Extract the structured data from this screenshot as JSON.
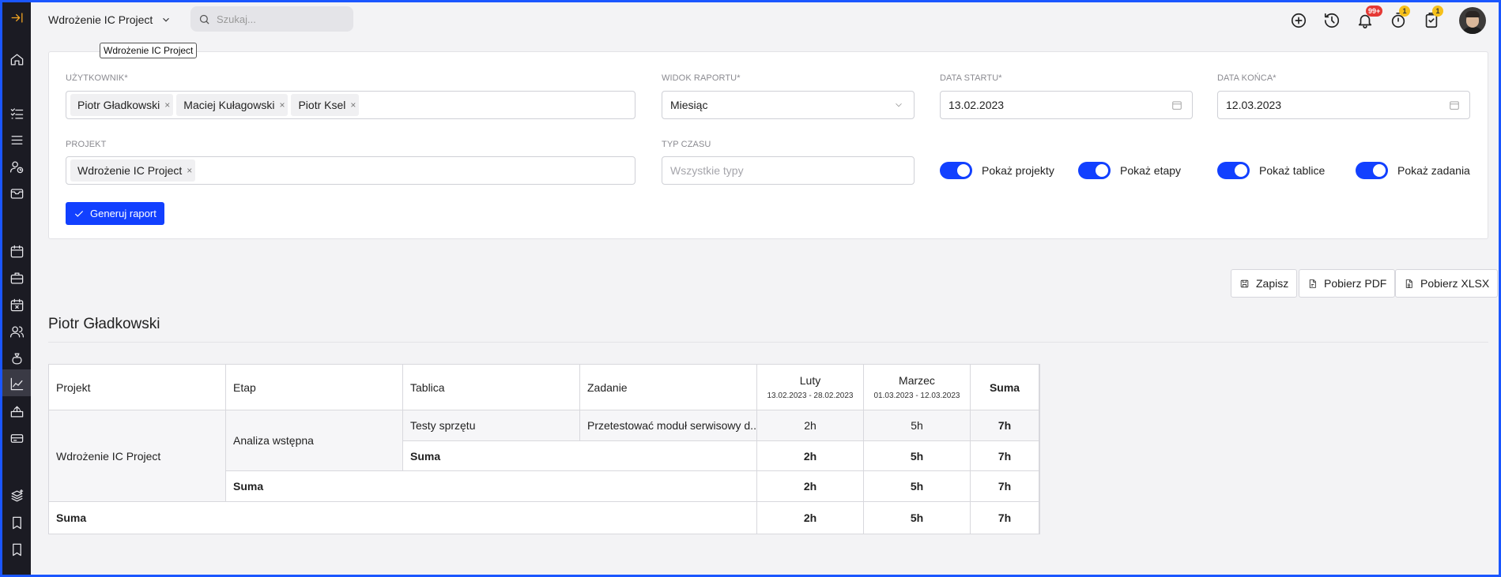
{
  "topbar": {
    "project_name": "Wdrożenie IC Project",
    "search_placeholder": "Szukaj...",
    "tooltip": "Wdrożenie IC Project",
    "notifications_badge": "99+",
    "timer_badge": "1",
    "tasks_badge": "1"
  },
  "filters": {
    "user_label": "UŻYTKOWNIK*",
    "users": [
      "Piotr Gładkowski",
      "Maciej Kułagowski",
      "Piotr Ksel"
    ],
    "view_label": "WIDOK RAPORTU*",
    "view_value": "Miesiąc",
    "start_label": "DATA STARTU*",
    "start_value": "13.02.2023",
    "end_label": "DATA KOŃCA*",
    "end_value": "12.03.2023",
    "project_label": "PROJEKT",
    "projects": [
      "Wdrożenie IC Project"
    ],
    "time_type_label": "TYP CZASU",
    "time_type_placeholder": "Wszystkie typy",
    "toggles": [
      "Pokaż projekty",
      "Pokaż etapy",
      "Pokaż tablice",
      "Pokaż zadania"
    ],
    "generate_label": "Generuj raport"
  },
  "actions": {
    "save": "Zapisz",
    "pdf": "Pobierz PDF",
    "xlsx": "Pobierz XLSX"
  },
  "report": {
    "person": "Piotr Gładkowski",
    "headers": {
      "project": "Projekt",
      "stage": "Etap",
      "board": "Tablica",
      "task": "Zadanie",
      "month1": "Luty",
      "month1_range": "13.02.2023  -  28.02.2023",
      "month2": "Marzec",
      "month2_range": "01.03.2023  -  12.03.2023",
      "sum": "Suma"
    },
    "project_name": "Wdrożenie IC Project",
    "stage_name": "Analiza wstępna",
    "board_name": "Testy sprzętu",
    "task_name": "Przetestować moduł serwisowy d...",
    "task_row": [
      "2h",
      "5h",
      "7h"
    ],
    "board_sum_label": "Suma",
    "board_sum": [
      "2h",
      "5h",
      "7h"
    ],
    "stage_sum_label": "Suma",
    "stage_sum": [
      "2h",
      "5h",
      "7h"
    ],
    "total_label": "Suma",
    "total": [
      "2h",
      "5h",
      "7h"
    ]
  }
}
